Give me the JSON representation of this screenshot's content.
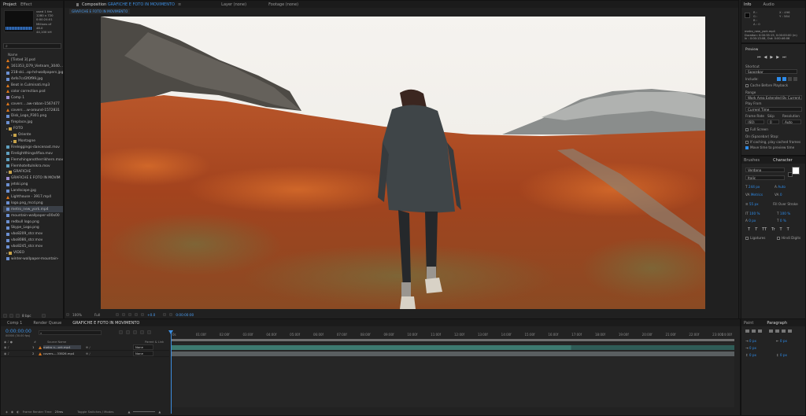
{
  "project": {
    "tabs": [
      "Project",
      "Effect"
    ],
    "thumb_info": [
      "used 1 tim",
      "1280 x 720",
      "0:00:24:01",
      "Millions of",
      "48.0",
      "44,100 kH"
    ],
    "search_placeholder": "",
    "col_name": "Name",
    "items": [
      {
        "label": "[Tinted 3].psd",
        "icon": "cone",
        "indent": 0
      },
      {
        "label": "161353_D79_Vietnam_3040...",
        "icon": "cone",
        "indent": 0
      },
      {
        "label": "218-ski...op-hd-wallpapers.jpg",
        "icon": "img",
        "indent": 0
      },
      {
        "label": "4efe7cd3f0f99.jpg",
        "icon": "img",
        "indent": 0
      },
      {
        "label": "Beat in Culminati.mp3",
        "icon": "cone",
        "indent": 0
      },
      {
        "label": "color correction.psd",
        "icon": "cone",
        "indent": 0
      },
      {
        "label": "Comp 1",
        "icon": "comp",
        "indent": 0
      },
      {
        "label": "covers ...aw-raban-1567477",
        "icon": "cone",
        "indent": 0
      },
      {
        "label": "covers ...w-around-1572831",
        "icon": "cone",
        "indent": 0
      },
      {
        "label": "Disk_Logo_P301.png",
        "icon": "img",
        "indent": 0
      },
      {
        "label": "fireplace.jpg",
        "icon": "img",
        "indent": 0
      },
      {
        "label": "FOTO",
        "icon": "folder",
        "indent": 0
      },
      {
        "label": "Oriente",
        "icon": "folder",
        "indent": 1
      },
      {
        "label": "Montagne",
        "icon": "folder",
        "indent": 1
      },
      {
        "label": "Fireleggings-dancenast.mov",
        "icon": "vid",
        "indent": 0
      },
      {
        "label": "Firelightthings4fixa.mov",
        "icon": "vid",
        "indent": 0
      },
      {
        "label": "Flemshinganotherrikhern.mov",
        "icon": "vid",
        "indent": 0
      },
      {
        "label": "Flemhoteltulnikra.mov",
        "icon": "vid",
        "indent": 0
      },
      {
        "label": "GRAFICHE",
        "icon": "folder",
        "indent": 0
      },
      {
        "label": "GRAFICHE E FOTO IN MOVIM",
        "icon": "comp",
        "indent": 0
      },
      {
        "label": "jetski.png",
        "icon": "img",
        "indent": 0
      },
      {
        "label": "Landscape.jpg",
        "icon": "img",
        "indent": 0
      },
      {
        "label": "Lighthouse - 3917.mp4",
        "icon": "cone",
        "indent": 0
      },
      {
        "label": "logo.png_mcd.png",
        "icon": "img",
        "indent": 0
      },
      {
        "label": "metro_new_york.mp4",
        "icon": "img",
        "indent": 0
      },
      {
        "label": "mountain-wallpaper-x00x00",
        "icon": "img",
        "indent": 0
      },
      {
        "label": "redbull logo.png",
        "icon": "img",
        "indent": 0
      },
      {
        "label": "Skype_Logo.png",
        "icon": "img",
        "indent": 0
      },
      {
        "label": "vbo8209_stcr.mov",
        "icon": "img",
        "indent": 0
      },
      {
        "label": "vbo8086_stcr.mov",
        "icon": "img",
        "indent": 0
      },
      {
        "label": "vbo8245_stcr.mov",
        "icon": "img",
        "indent": 0
      },
      {
        "label": "VIDEO",
        "icon": "folder",
        "indent": 0
      },
      {
        "label": "winter-wallpaper-mountain-",
        "icon": "img",
        "indent": 0
      }
    ],
    "bpc": "8 bpc"
  },
  "composition": {
    "title_prefix": "Composition",
    "title": "GRAFICHE E FOTO IN MOVIMENTO",
    "layer_tab": "Layer (none)",
    "footage_tab": "Footage (none)",
    "subtab": "GRAFICHE E FOTO IN MOVIMENTO",
    "zoom": "100%",
    "resolution": "Full",
    "exposure": "+0.0",
    "timecode": "0:00:00:00"
  },
  "info": {
    "tabs": [
      "Info",
      "Audio"
    ],
    "rgba": [
      "R :",
      "G :",
      "B :",
      "A : 0"
    ],
    "coords": [
      "X : 496",
      "Y : 584"
    ],
    "file_lines": [
      "metro_new_york.mp4",
      "Duration: 0:00:35:15, 0:00:00:00 (in)",
      "In : 0:00:13:08, Out: 0:00:46:06"
    ]
  },
  "preview": {
    "title": "Preview",
    "shortcut_label": "Shortcut",
    "shortcut_value": "Spacebar",
    "include_label": "Include:",
    "cache_label": "Cache Before Playback",
    "range_label": "Range",
    "range_value": "Work Area Extended By Current...",
    "playfrom_label": "Play From",
    "playfrom_value": "Current Time",
    "framerate_label": "Frame Rate",
    "skip_label": "Skip",
    "resolution_label": "Resolution",
    "framerate_value": "(60)",
    "skip_value": "0",
    "resolution_value": "Auto",
    "fullscreen_label": "Full Screen",
    "onstop_label": "On (Spacebar) Stop:",
    "cache_opt": "If caching, play cached frames",
    "movetime_opt": "Move time to preview time"
  },
  "character": {
    "tabs": [
      "Brushes",
      "Character"
    ],
    "font": "Verdana",
    "style": "Italic",
    "size": "244 px",
    "leading": "Auto",
    "tracking": "Metrics",
    "kerning": "0",
    "stroke": "55 px",
    "stroke_type": "Fill Over Stroke",
    "vscale": "100 %",
    "hscale": "100 %",
    "baseline": "0 px",
    "tsume": "0 %",
    "format_buttons": [
      "T",
      "T",
      "TT",
      "Tr",
      "T",
      "T"
    ],
    "ligatures": "Ligatures",
    "hindi": "Hindi Digits"
  },
  "timeline": {
    "tabs": [
      "Comp 1",
      "Render Queue",
      "GRAFICHE E FOTO IN MOVIMENTO"
    ],
    "timecode": "0:00:00:00",
    "frames": "00000 (30.00 fps)",
    "col_headers": [
      "#",
      "Source Name",
      "Parent & Link"
    ],
    "layers": [
      {
        "num": "1",
        "name": "metro n...ork.mp4",
        "parent": "None"
      },
      {
        "num": "2",
        "name": "covers-...33826.mp4",
        "parent": "None"
      }
    ],
    "ruler": [
      "0s",
      "01:00f",
      "02:00f",
      "03:00f",
      "04:00f",
      "05:00f",
      "06:00f",
      "07:00f",
      "08:00f",
      "09:00f",
      "10:00f",
      "11:00f",
      "12:00f",
      "13:00f",
      "14:00f",
      "15:00f",
      "16:00f",
      "17:00f",
      "18:00f",
      "19:00f",
      "20:00f",
      "21:00f",
      "22:00f",
      "23:00f",
      "24:00f"
    ],
    "frame_render_label": "Frame Render Time",
    "frame_render_value": "23ms",
    "toggle_label": "Toggle Switches / Modes"
  },
  "paragraph": {
    "tabs": [
      "Paint",
      "Paragraph"
    ],
    "fields": [
      "0 px",
      "0 px",
      "0 px",
      "0 px",
      "0 px"
    ]
  },
  "colors": {
    "accent": "#2d8ceb",
    "track_teal": "#3d7a70",
    "track_gray": "#5a5f61"
  }
}
